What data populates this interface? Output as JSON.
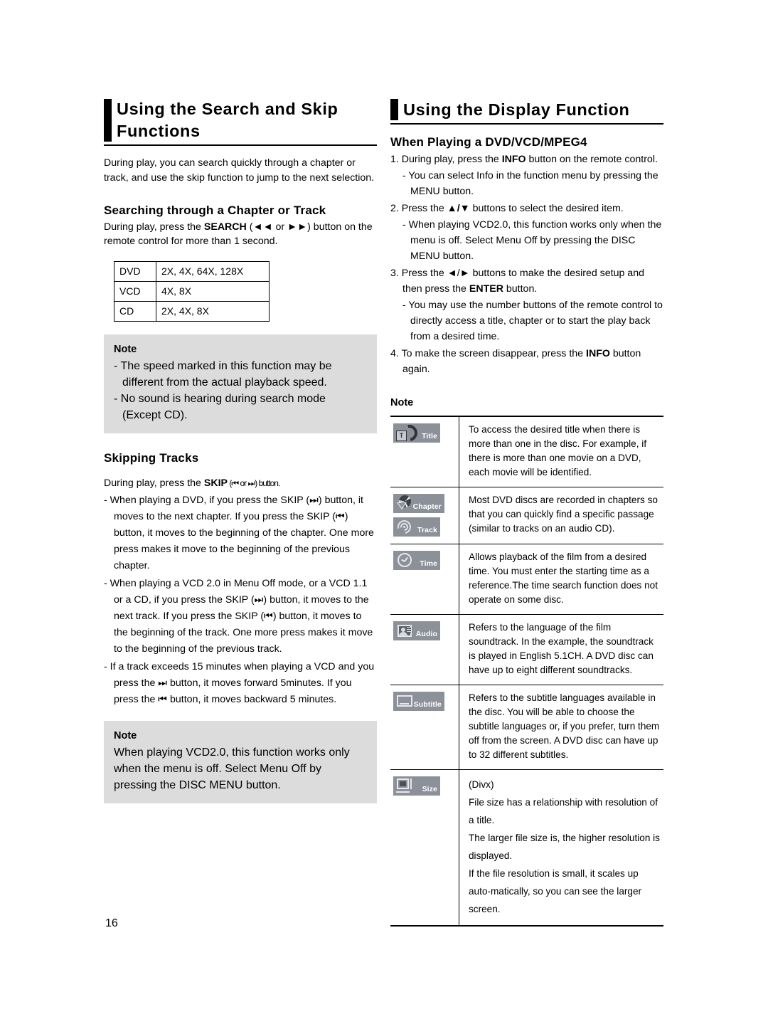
{
  "page": {
    "number": "16"
  },
  "left_column": {
    "section_title": "Using the Search and Skip Functions",
    "intro": "During play, you can search quickly through a chapter or track, and use the skip function to jump to the next selection.",
    "searching": {
      "heading": "Searching through a Chapter or Track",
      "instruction_pre": "During play, press the ",
      "instruction_bold": "SEARCH",
      "instruction_mid": " (◄◄ or ►►) button on the",
      "instruction_post": "remote control for more than 1 second."
    },
    "speed_table": {
      "rows": [
        {
          "format": "DVD",
          "speeds": "2X, 4X, 64X, 128X"
        },
        {
          "format": "VCD",
          "speeds": "4X, 8X"
        },
        {
          "format": "CD",
          "speeds": "2X, 4X, 8X"
        }
      ]
    },
    "note_1": {
      "title": "Note",
      "lines": [
        "- The speed marked in this function may be different from the actual playback speed.",
        "- No sound is hearing during search mode (Except CD)."
      ]
    },
    "skipping": {
      "heading": "Skipping Tracks",
      "intro_pre": "During play, press the ",
      "intro_bold": "SKIP",
      "intro_post": " (⏮  or  ⏭) button.",
      "bullets": [
        "- When playing a DVD, if you press the SKIP (⏭) button, it moves to the next chapter. If you press the SKIP (⏮) button, it moves to the beginning of the chapter. One more press makes it move to the beginning of the previous chapter.",
        "- When playing a VCD 2.0 in Menu Off mode, or a VCD 1.1 or a CD, if you press the SKIP (⏭) button, it moves to the next track. If you press the SKIP (⏮) button, it moves to the beginning of the track. One more press makes it move to the beginning of the previous track.",
        "- If a track exceeds 15 minutes when playing a VCD and you press the ⏭ button, it moves forward 5minutes. If you press the ⏮ button, it moves backward 5 minutes."
      ]
    },
    "note_2": {
      "title": "Note",
      "body": "When playing VCD2.0, this function works only when the menu is off. Select Menu Off by pressing the DISC MENU button."
    }
  },
  "right_column": {
    "section_title": "Using the Display Function",
    "sub_heading": "When Playing a DVD/VCD/MPEG4",
    "steps": [
      {
        "num": "1.",
        "text_pre": "During play, press the ",
        "text_bold": "INFO",
        "text_post": " button on the remote control.",
        "subs": [
          "- You can select Info in the function menu by pressing the MENU button."
        ]
      },
      {
        "num": "2.",
        "text_pre": "Press the ",
        "text_bold": "▲/▼",
        "text_post": " buttons to select the desired item.",
        "subs": [
          "- When playing VCD2.0, this function works only when the menu is off. Select Menu Off by pressing the DISC MENU button."
        ]
      },
      {
        "num": "3.",
        "text_pre": "Press the ◄/► buttons to make the desired setup and then press the ",
        "text_bold": "ENTER",
        "text_post": " button.",
        "subs": [
          "- You may use the number buttons of the remote control to directly access a title, chapter or to start the play back from a desired time."
        ]
      },
      {
        "num": "4.",
        "text_pre": "To make the screen disappear, press the ",
        "text_bold": "INFO",
        "text_post": " button again.",
        "subs": []
      }
    ],
    "note_heading": "Note",
    "icon_table": {
      "rows": [
        {
          "icons": [
            {
              "label": "Title",
              "glyph": "title-icon"
            }
          ],
          "paragraphs": [
            "To access the desired title when there is more than one in the disc. For example, if there is more than one movie on a DVD, each movie will be identified."
          ]
        },
        {
          "icons": [
            {
              "label": "Chapter",
              "glyph": "chapter-icon"
            },
            {
              "label": "Track",
              "glyph": "track-icon"
            }
          ],
          "paragraphs": [
            "Most DVD discs are recorded in chapters so that you can quickly find a specific passage (similar to tracks on an audio CD)."
          ]
        },
        {
          "icons": [
            {
              "label": "Time",
              "glyph": "time-icon"
            }
          ],
          "paragraphs": [
            "Allows playback of the film from a desired time. You must enter the starting time as a reference.The time search function does not operate on some disc."
          ]
        },
        {
          "icons": [
            {
              "label": "Audio",
              "glyph": "audio-icon"
            }
          ],
          "paragraphs": [
            "Refers to the language of the film soundtrack. In the example, the soundtrack is played in English 5.1CH. A DVD disc can have up to eight different soundtracks."
          ]
        },
        {
          "icons": [
            {
              "label": "Subtitle",
              "glyph": "subtitle-icon"
            }
          ],
          "paragraphs": [
            "Refers to the subtitle languages available in the disc. You will be able to choose the subtitle languages or, if you prefer, turn them off from the screen. A DVD disc can have up to 32 different subtitles."
          ]
        },
        {
          "icons": [
            {
              "label": "Size",
              "glyph": "size-icon"
            }
          ],
          "paragraphs": [
            "(Divx)",
            "File size has a relationship with resolution of a title.",
            "The larger file size is, the higher resolution is displayed.",
            "If the file resolution is small, it scales up auto-matically, so you can see the larger screen."
          ]
        }
      ]
    }
  }
}
